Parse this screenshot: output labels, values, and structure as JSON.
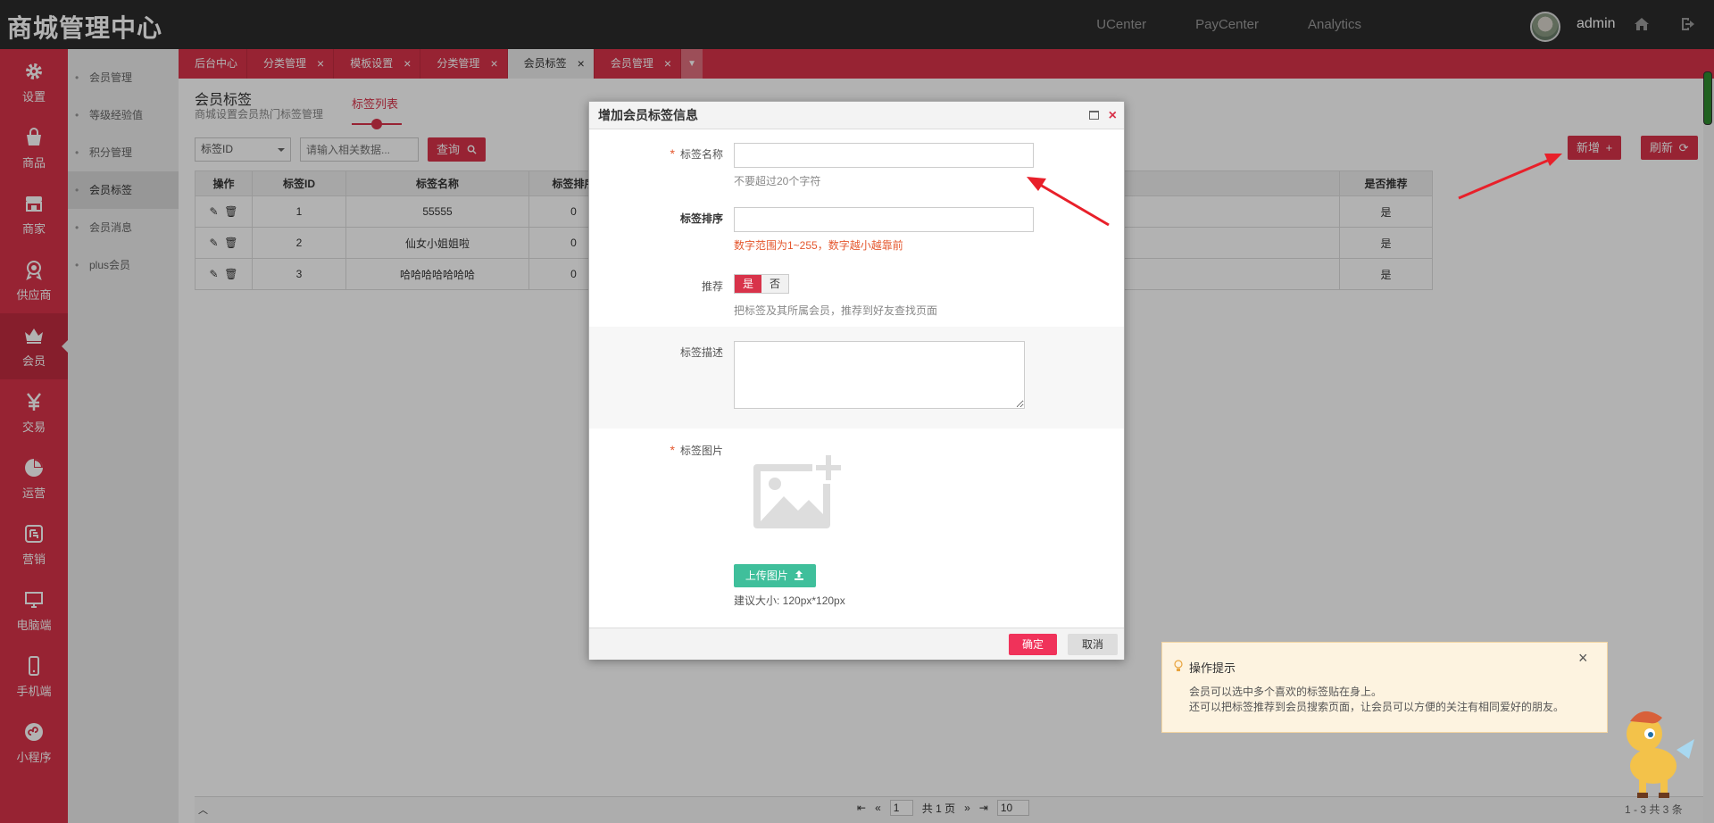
{
  "header": {
    "brand": "商城管理中心",
    "nav": [
      "UCenter",
      "PayCenter",
      "Analytics"
    ],
    "username": "admin"
  },
  "sidebar": {
    "items": [
      {
        "label": "设置",
        "icon": "gear-icon"
      },
      {
        "label": "商品",
        "icon": "bag-icon"
      },
      {
        "label": "商家",
        "icon": "store-icon"
      },
      {
        "label": "供应商",
        "icon": "badge-icon"
      },
      {
        "label": "会员",
        "icon": "crown-icon",
        "active": true
      },
      {
        "label": "交易",
        "icon": "yen-icon"
      },
      {
        "label": "运营",
        "icon": "pie-icon"
      },
      {
        "label": "营销",
        "icon": "promo-icon"
      },
      {
        "label": "电脑端",
        "icon": "monitor-icon"
      },
      {
        "label": "手机端",
        "icon": "phone-icon"
      },
      {
        "label": "小程序",
        "icon": "miniprogram-icon"
      }
    ]
  },
  "subnav": {
    "items": [
      "会员管理",
      "等级经验值",
      "积分管理",
      "会员标签",
      "会员消息",
      "plus会员"
    ],
    "active_index": 3
  },
  "tabs": {
    "items": [
      {
        "label": "后台中心",
        "closable": false
      },
      {
        "label": "分类管理",
        "closable": true
      },
      {
        "label": "模板设置",
        "closable": true
      },
      {
        "label": "分类管理",
        "closable": true
      },
      {
        "label": "会员标签",
        "closable": true,
        "active": true
      },
      {
        "label": "会员管理",
        "closable": true
      }
    ]
  },
  "page": {
    "title": "会员标签",
    "subtitle": "商城设置会员热门标签管理",
    "list_tab": "标签列表",
    "filter_select": "标签ID",
    "search_placeholder": "请输入相关数据...",
    "search_button": "查询",
    "add_button": "新增",
    "refresh_button": "刷新"
  },
  "table": {
    "columns": [
      "操作",
      "标签ID",
      "标签名称",
      "标签排序",
      "是否推荐"
    ],
    "rows": [
      {
        "id": "1",
        "name": "55555",
        "sort": "0",
        "recommend": "是"
      },
      {
        "id": "2",
        "name": "仙女小姐姐啦",
        "sort": "0",
        "recommend": "是"
      },
      {
        "id": "3",
        "name": "哈哈哈哈哈哈哈",
        "sort": "0",
        "recommend": "是"
      }
    ]
  },
  "pager": {
    "page": "1",
    "total_pages": "共 1 页",
    "page_size": "10",
    "range": "1 - 3 共 3 条"
  },
  "dialog": {
    "title": "增加会员标签信息",
    "name_label": "标签名称",
    "name_hint": "不要超过20个字符",
    "sort_label": "标签排序",
    "sort_hint": "数字范围为1~255，数字越小越靠前",
    "recommend_label": "推荐",
    "recommend_yes": "是",
    "recommend_no": "否",
    "recommend_hint": "把标签及其所属会员，推荐到好友查找页面",
    "desc_label": "标签描述",
    "image_label": "标签图片",
    "upload_button": "上传图片",
    "size_hint": "建议大小: 120px*120px",
    "ok": "确定",
    "cancel": "取消"
  },
  "tip": {
    "title": "操作提示",
    "line1": "会员可以选中多个喜欢的标签贴在身上。",
    "line2": "还可以把标签推荐到会员搜索页面，让会员可以方便的关注有相同爱好的朋友。"
  },
  "colors": {
    "brand_red": "#d8334a",
    "header_dark": "#2b2b2b",
    "upload_green": "#3fbf9b",
    "arrow_red": "#e8202a"
  }
}
